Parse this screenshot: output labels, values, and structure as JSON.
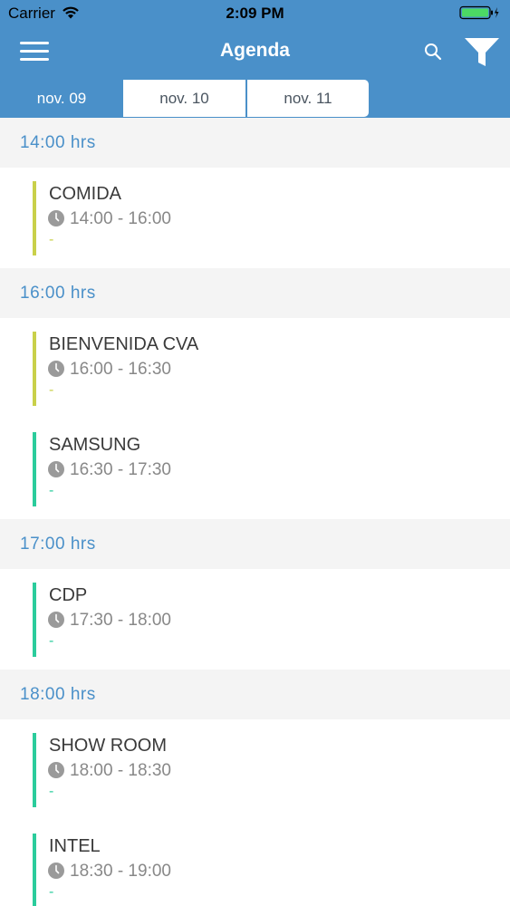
{
  "status_bar": {
    "carrier": "Carrier",
    "time": "2:09 PM"
  },
  "nav": {
    "title": "Agenda",
    "menu_icon": "hamburger-menu-icon",
    "search_icon": "search-icon",
    "filter_icon": "filter-funnel-icon"
  },
  "tabs": [
    {
      "label": "nov. 09",
      "selected": true
    },
    {
      "label": "nov. 10",
      "selected": false
    },
    {
      "label": "nov. 11",
      "selected": false
    }
  ],
  "colors": {
    "primary": "#4a90c9",
    "bar_yellow": "#c9d04a",
    "bar_green": "#2bcc9c",
    "section_bg": "#f4f4f4"
  },
  "sections": [
    {
      "label": "14:00 hrs"
    },
    {
      "label": "16:00 hrs"
    },
    {
      "label": "17:00 hrs"
    },
    {
      "label": "18:00 hrs"
    }
  ],
  "events": [
    {
      "title": "COMIDA",
      "time": "14:00 - 16:00",
      "detail": "-",
      "color": "#c9d04a"
    },
    {
      "title": "BIENVENIDA CVA",
      "time": "16:00 - 16:30",
      "detail": "-",
      "color": "#c9d04a"
    },
    {
      "title": "SAMSUNG",
      "time": "16:30 - 17:30",
      "detail": "-",
      "color": "#2bcc9c"
    },
    {
      "title": "CDP",
      "time": "17:30 - 18:00",
      "detail": "-",
      "color": "#2bcc9c"
    },
    {
      "title": "SHOW ROOM",
      "time": "18:00 - 18:30",
      "detail": "-",
      "color": "#2bcc9c"
    },
    {
      "title": "INTEL",
      "time": "18:30 - 19:00",
      "detail": "-",
      "color": "#2bcc9c"
    }
  ]
}
